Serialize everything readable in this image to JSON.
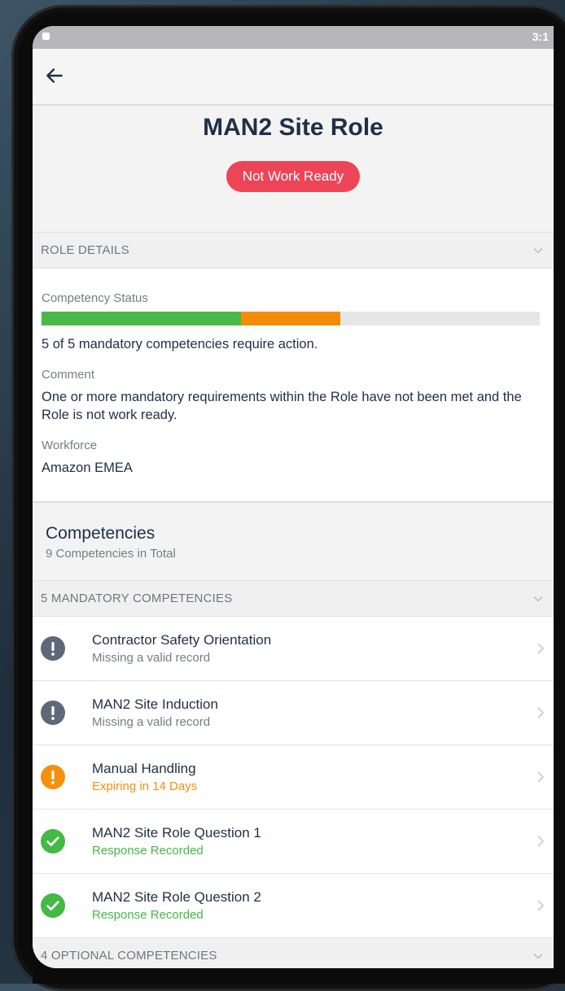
{
  "status_bar": {
    "time": "3:1"
  },
  "header": {
    "title": "MAN2 Site Role",
    "status": "Not Work Ready"
  },
  "role_details": {
    "section_label": "ROLE DETAILS",
    "competency_status_label": "Competency Status",
    "progress": {
      "complete_fraction": 0.4,
      "pending_fraction": 0.2
    },
    "competency_status_text": "5 of 5 mandatory competencies require action.",
    "comment_label": "Comment",
    "comment_text": "One or more mandatory requirements within the Role have not been met and the Role is not work ready.",
    "workforce_label": "Workforce",
    "workforce_value": "Amazon EMEA"
  },
  "competencies": {
    "title": "Competencies",
    "subtitle": "9 Competencies in Total",
    "mandatory_label": "5 MANDATORY COMPETENCIES",
    "optional_label": "4 OPTIONAL COMPETENCIES",
    "items": [
      {
        "title": "Contractor Safety Orientation",
        "status": "Missing a valid record",
        "state": "missing",
        "icon": "exclamation-icon"
      },
      {
        "title": "MAN2 Site Induction",
        "status": "Missing a valid record",
        "state": "missing",
        "icon": "exclamation-icon"
      },
      {
        "title": "Manual Handling",
        "status": "Expiring in 14 Days",
        "state": "expiring",
        "icon": "exclamation-icon"
      },
      {
        "title": "MAN2 Site Role Question 1",
        "status": "Response Recorded",
        "state": "done",
        "icon": "check-circle-icon"
      },
      {
        "title": "MAN2 Site Role Question 2",
        "status": "Response Recorded",
        "state": "done",
        "icon": "check-circle-icon"
      }
    ]
  },
  "colors": {
    "title_text": "#1f2f45",
    "badge_red": "#ee4458",
    "progress_green": "#49b947",
    "progress_orange": "#f58c09",
    "missing_gray": "#5f6878",
    "expiring_orange": "#f5900e",
    "done_green": "#45b845"
  }
}
